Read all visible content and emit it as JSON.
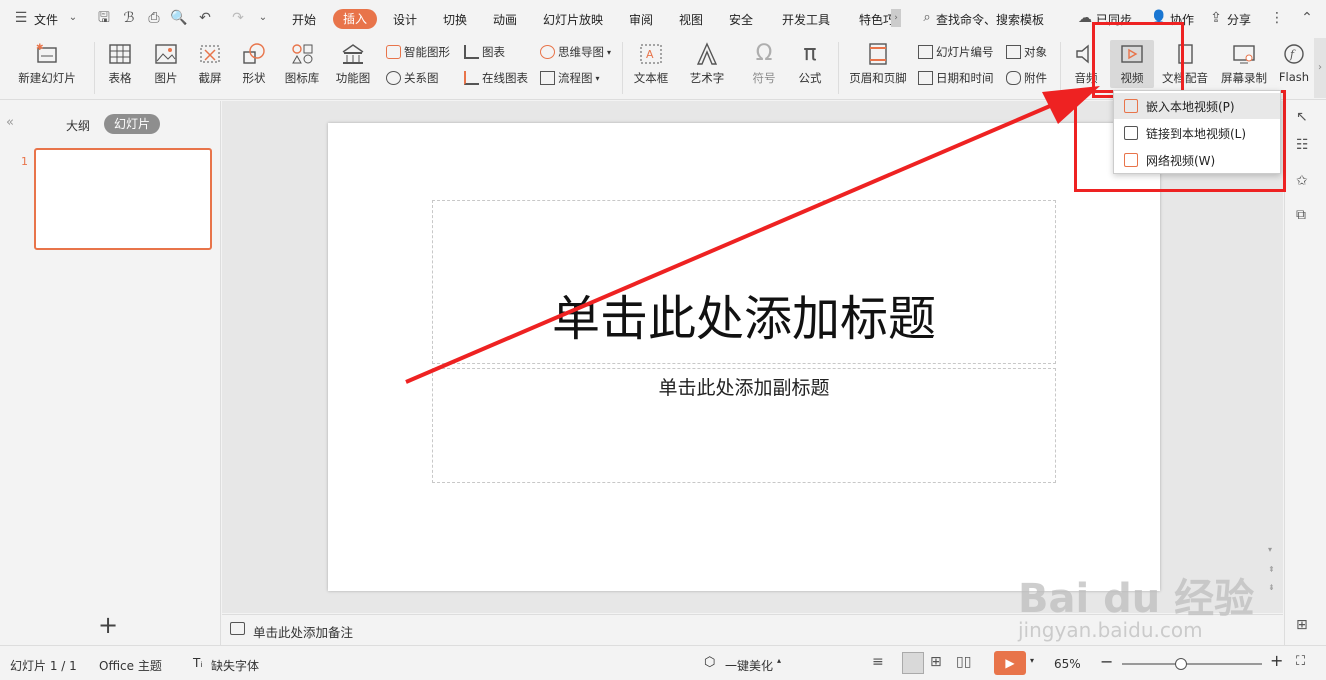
{
  "menubar": {
    "file_label": "文件",
    "tabs": [
      "开始",
      "插入",
      "设计",
      "切换",
      "动画",
      "幻灯片放映",
      "审阅",
      "视图",
      "安全",
      "开发工具",
      "特色巧"
    ],
    "active_tab": "插入",
    "search_label": "查找命令、搜索模板",
    "sync_label": "已同步",
    "collab_label": "协作",
    "share_label": "分享"
  },
  "ribbon": {
    "new_slide": "新建幻灯片",
    "table": "表格",
    "picture": "图片",
    "screenshot": "截屏",
    "shape": "形状",
    "icon_lib": "图标库",
    "func_chart": "功能图",
    "smart_shape": "智能图形",
    "chart": "图表",
    "mindmap": "思维导图",
    "relation": "关系图",
    "online_chart": "在线图表",
    "flowchart": "流程图",
    "textbox": "文本框",
    "wordart": "艺术字",
    "symbol": "符号",
    "formula": "公式",
    "header_footer": "页眉和页脚",
    "slide_number": "幻灯片编号",
    "object": "对象",
    "datetime": "日期和时间",
    "attachment": "附件",
    "audio": "音频",
    "video": "视频",
    "doc_dub": "文档配音",
    "screen_record": "屏幕录制",
    "flash": "Flash"
  },
  "video_menu": {
    "items": [
      "嵌入本地视频(P)",
      "链接到本地视频(L)",
      "网络视频(W)"
    ]
  },
  "left_panel": {
    "tab_outline": "大纲",
    "tab_slides": "幻灯片",
    "slide_index": "1",
    "add_symbol": "+"
  },
  "slide": {
    "title_placeholder": "单击此处添加标题",
    "subtitle_placeholder": "单击此处添加副标题"
  },
  "notes": {
    "placeholder": "单击此处添加备注"
  },
  "status": {
    "slide_counter": "幻灯片 1 / 1",
    "theme": "Office 主题",
    "missing_font": "缺失字体",
    "beautify": "一键美化",
    "zoom": "65%",
    "zoom_fraction": 0.42
  },
  "watermark": {
    "brand": "Bai du 经验",
    "url": "jingyan.baidu.com"
  },
  "colors": {
    "accent": "#e8744a",
    "annotation_red": "#ee2222"
  }
}
